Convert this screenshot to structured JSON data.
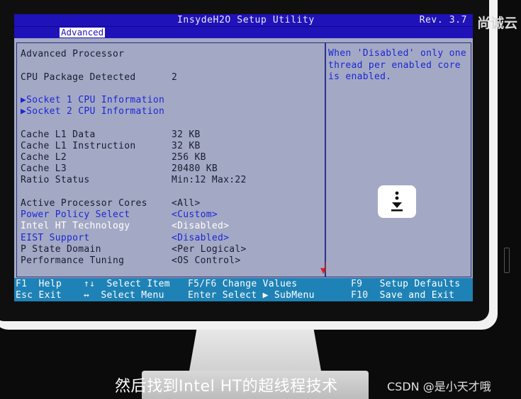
{
  "brand_logo": "尚诚云",
  "bios": {
    "title": "InsydeH2O Setup Utility",
    "revision": "Rev. 3.7",
    "active_tab": "Advanced",
    "rows": [
      {
        "label": "Advanced Processor",
        "value": "",
        "color": "dark"
      },
      {
        "label": "CPU Package Detected",
        "value": "2",
        "color": "dark"
      },
      {
        "label": "▶Socket 1 CPU Information",
        "value": "",
        "color": "blue"
      },
      {
        "label": "▶Socket 2 CPU Information",
        "value": "",
        "color": "blue"
      },
      {
        "label": "Cache L1 Data",
        "value": "32 KB",
        "color": "dark"
      },
      {
        "label": "Cache L1 Instruction",
        "value": "32 KB",
        "color": "dark"
      },
      {
        "label": "Cache L2",
        "value": "256 KB",
        "color": "dark"
      },
      {
        "label": "Cache L3",
        "value": "20480 KB",
        "color": "dark"
      },
      {
        "label": "Ratio Status",
        "value": "Min:12 Max:22",
        "color": "dark"
      },
      {
        "label": "Active Processor Cores",
        "value": "<All>",
        "color": "dark"
      },
      {
        "label": "Power Policy Select",
        "value": "<Custom>",
        "color": "blue"
      },
      {
        "label": "Intel HT Technology",
        "value": "<Disabled>",
        "color": "white"
      },
      {
        "label": "EIST Support",
        "value": "<Disabled>",
        "color": "blue"
      },
      {
        "label": "P State Domain",
        "value": "<Per Logical>",
        "color": "dark"
      },
      {
        "label": "Performance Tuning",
        "value": "<OS Control>",
        "color": "dark"
      }
    ],
    "help_text": "When 'Disabled' only one thread per enabled core is enabled.",
    "keys": [
      {
        "key": "F1",
        "desc": "Help"
      },
      {
        "key": "Esc",
        "desc": "Exit"
      },
      {
        "key": "↑↓",
        "desc": "Select Item"
      },
      {
        "key": "↔",
        "desc": "Select Menu"
      },
      {
        "key": "F5/F6",
        "desc": "Change Values"
      },
      {
        "key": "Enter",
        "desc": "Select ▶ SubMenu"
      },
      {
        "key": "F9",
        "desc": "Setup Defaults"
      },
      {
        "key": "F10",
        "desc": "Save and Exit"
      }
    ]
  },
  "overlay_icon": "more-vertical-download-icon",
  "subtitle": "然后找到Intel HT的超线程技术",
  "watermark": "CSDN @是小天才哦"
}
